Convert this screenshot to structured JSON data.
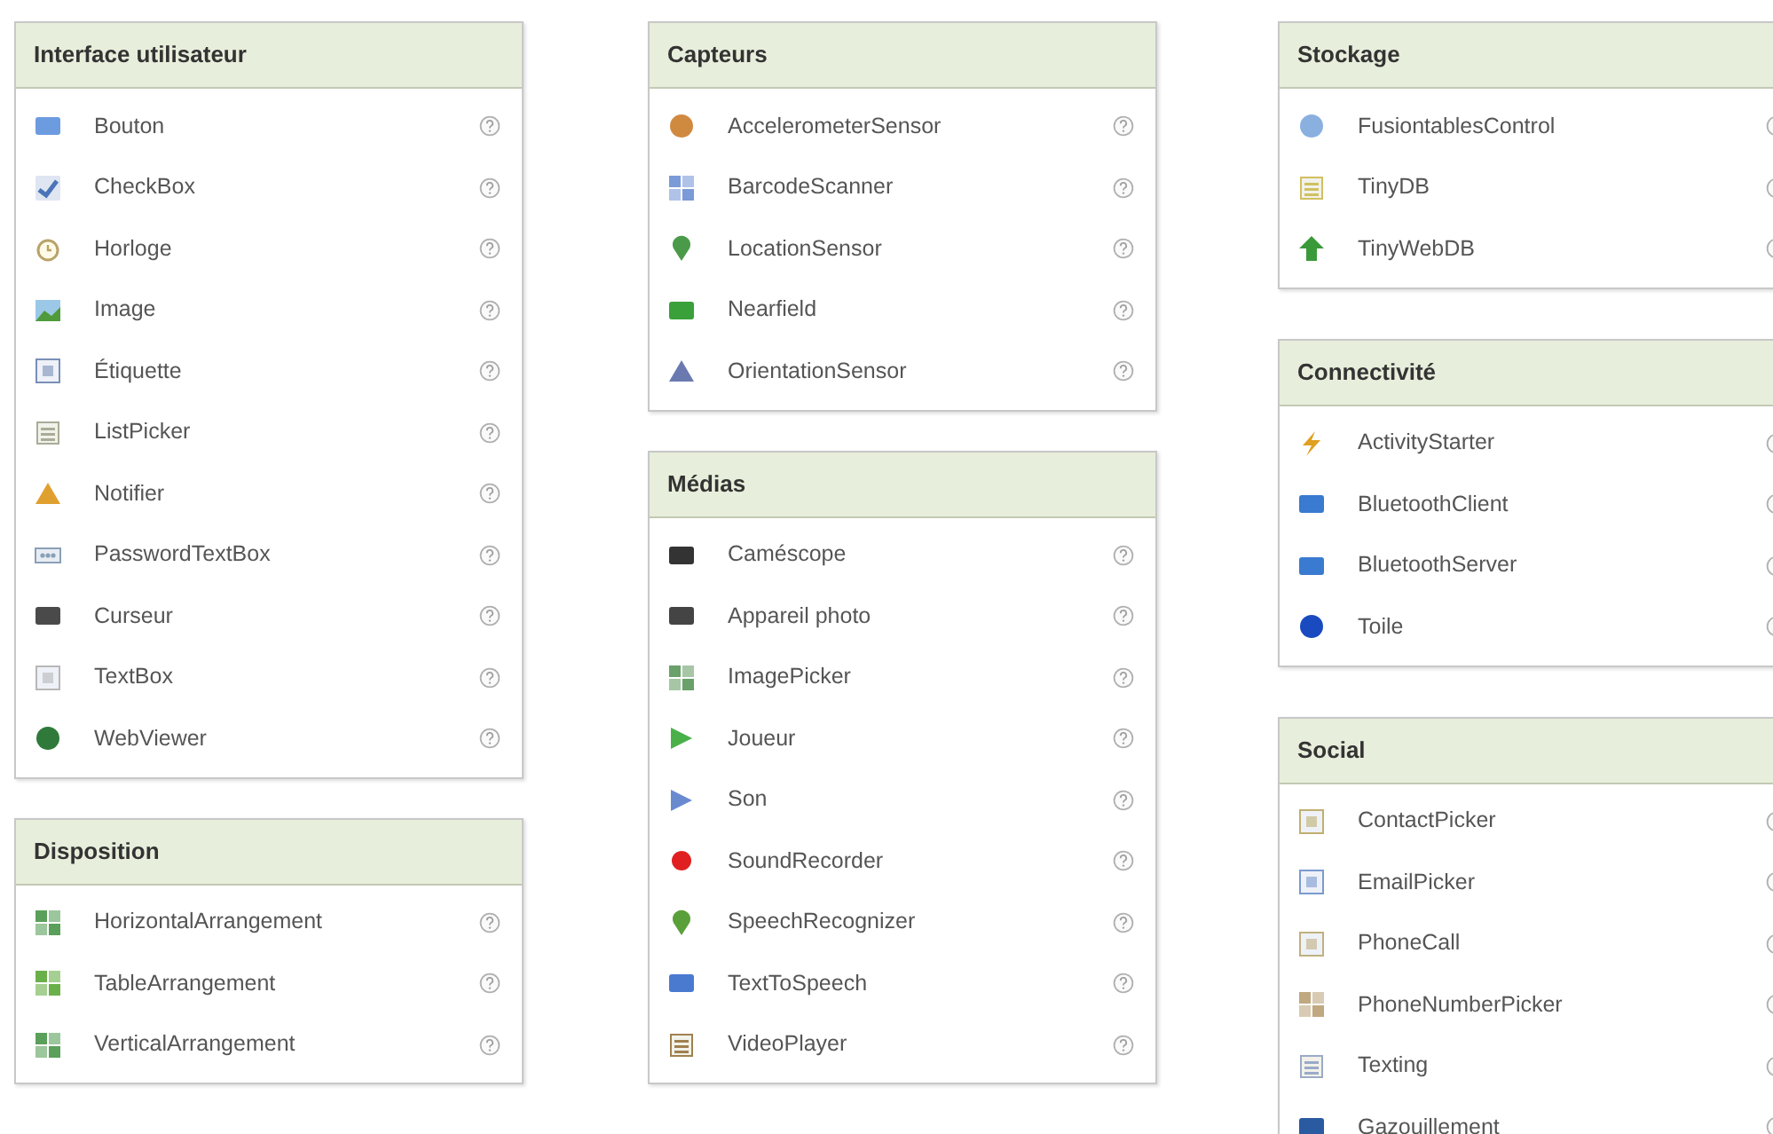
{
  "columns": [
    {
      "panels": [
        {
          "title": "Interface utilisateur",
          "items": [
            "Bouton",
            "CheckBox",
            "Horloge",
            "Image",
            "Étiquette",
            "ListPicker",
            "Notifier",
            "PasswordTextBox",
            "Curseur",
            "TextBox",
            "WebViewer"
          ]
        },
        {
          "title": "Disposition",
          "items": [
            "HorizontalArrangement",
            "TableArrangement",
            "VerticalArrangement"
          ]
        }
      ]
    },
    {
      "panels": [
        {
          "title": "Capteurs",
          "items": [
            "AccelerometerSensor",
            "BarcodeScanner",
            "LocationSensor",
            "Nearfield",
            "OrientationSensor"
          ]
        },
        {
          "title": "Médias",
          "items": [
            "Caméscope",
            "Appareil photo",
            "ImagePicker",
            "Joueur",
            "Son",
            "SoundRecorder",
            "SpeechRecognizer",
            "TextToSpeech",
            "VideoPlayer"
          ]
        }
      ]
    },
    {
      "panels": [
        {
          "title": "Stockage",
          "items": [
            "FusiontablesControl",
            "TinyDB",
            "TinyWebDB"
          ]
        },
        {
          "title": "Connectivité",
          "items": [
            "ActivityStarter",
            "BluetoothClient",
            "BluetoothServer",
            "Toile"
          ]
        },
        {
          "title": "Social",
          "items": [
            "ContactPicker",
            "EmailPicker",
            "PhoneCall",
            "PhoneNumberPicker",
            "Texting",
            "Gazouillement"
          ]
        }
      ]
    }
  ]
}
